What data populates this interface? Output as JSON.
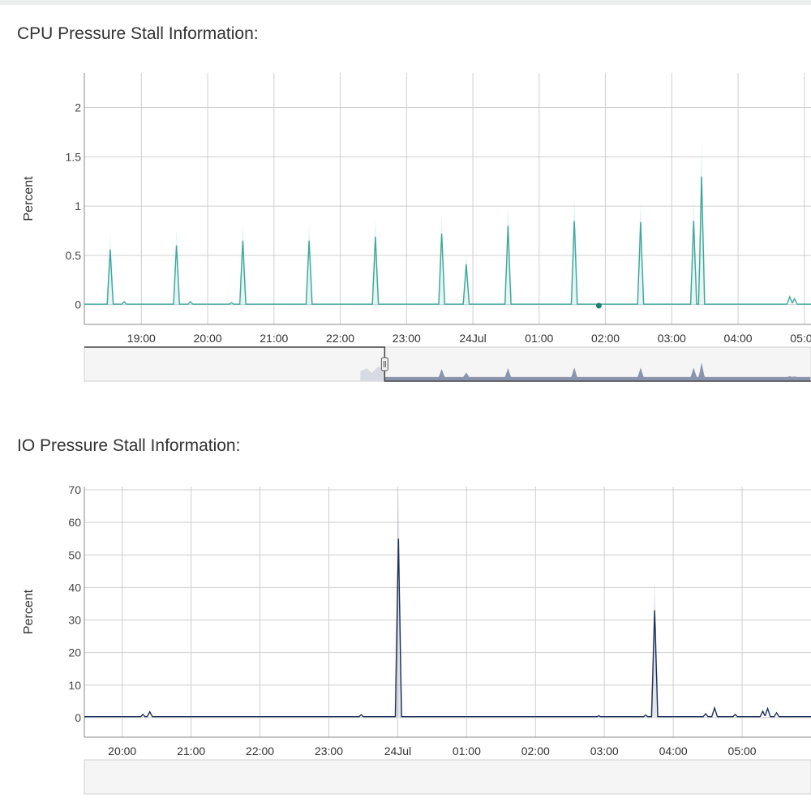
{
  "charts": {
    "cpu": {
      "title": "CPU Pressure Stall Information:"
    },
    "io": {
      "title": "IO Pressure Stall Information:"
    }
  },
  "chart_data": [
    {
      "type": "line",
      "title": "CPU Pressure Stall Information:",
      "ylabel": "Percent",
      "ylim": [
        -0.2,
        2.35
      ],
      "y_ticks": [
        0,
        0.5,
        1,
        1.5,
        2
      ],
      "y_tick_labels": [
        "0",
        "0.5",
        "1",
        "1.5",
        "2"
      ],
      "x_ticks": [
        19,
        20,
        21,
        22,
        23,
        24,
        25,
        26,
        27,
        28,
        29
      ],
      "x_tick_labels": [
        "19:00",
        "20:00",
        "21:00",
        "22:00",
        "23:00",
        "24Jul",
        "01:00",
        "02:00",
        "03:00",
        "04:00",
        "05:00"
      ],
      "xlim": [
        18.14,
        29.1
      ],
      "grid": true,
      "color": "#3aa89a",
      "baseline": 0.005,
      "spikes": [
        {
          "x": 18.53,
          "y": 0.56
        },
        {
          "x": 18.74,
          "y": 0.03
        },
        {
          "x": 19.53,
          "y": 0.6
        },
        {
          "x": 19.74,
          "y": 0.03
        },
        {
          "x": 20.53,
          "y": 0.65
        },
        {
          "x": 20.36,
          "y": 0.02
        },
        {
          "x": 21.53,
          "y": 0.65
        },
        {
          "x": 22.53,
          "y": 0.69
        },
        {
          "x": 23.53,
          "y": 0.72
        },
        {
          "x": 23.9,
          "y": 0.41
        },
        {
          "x": 24.53,
          "y": 0.8
        },
        {
          "x": 25.53,
          "y": 0.85
        },
        {
          "x": 26.53,
          "y": 0.84
        },
        {
          "x": 27.33,
          "y": 0.85
        },
        {
          "x": 27.45,
          "y": 1.3
        },
        {
          "x": 28.78,
          "y": 0.08
        },
        {
          "x": 28.85,
          "y": 0.06
        }
      ],
      "marker": {
        "x": 25.9,
        "y": -0.01
      },
      "navigator": {
        "selected_from": 22.67
      }
    },
    {
      "type": "line",
      "title": "IO Pressure Stall Information:",
      "ylabel": "Percent",
      "ylim": [
        -6,
        71
      ],
      "y_ticks": [
        0,
        10,
        20,
        30,
        40,
        50,
        60,
        70
      ],
      "y_tick_labels": [
        "0",
        "10",
        "20",
        "30",
        "40",
        "50",
        "60",
        "70"
      ],
      "x_ticks": [
        20,
        21,
        22,
        23,
        24,
        25,
        26,
        27,
        28,
        29
      ],
      "x_tick_labels": [
        "20:00",
        "21:00",
        "22:00",
        "23:00",
        "24Jul",
        "01:00",
        "02:00",
        "03:00",
        "04:00",
        "05:00"
      ],
      "xlim": [
        19.45,
        30.0
      ],
      "grid": true,
      "color": "#1c2f5c",
      "baseline": 0.3,
      "spikes": [
        {
          "x": 20.3,
          "y": 1.0
        },
        {
          "x": 20.4,
          "y": 1.8
        },
        {
          "x": 23.47,
          "y": 0.9
        },
        {
          "x": 24.01,
          "y": 55
        },
        {
          "x": 26.92,
          "y": 0.6
        },
        {
          "x": 27.6,
          "y": 0.8
        },
        {
          "x": 27.73,
          "y": 33
        },
        {
          "x": 28.47,
          "y": 1.2
        },
        {
          "x": 28.6,
          "y": 3.0
        },
        {
          "x": 28.9,
          "y": 1.0
        },
        {
          "x": 29.3,
          "y": 2.0
        },
        {
          "x": 29.37,
          "y": 2.8
        },
        {
          "x": 29.5,
          "y": 1.5
        }
      ]
    }
  ]
}
